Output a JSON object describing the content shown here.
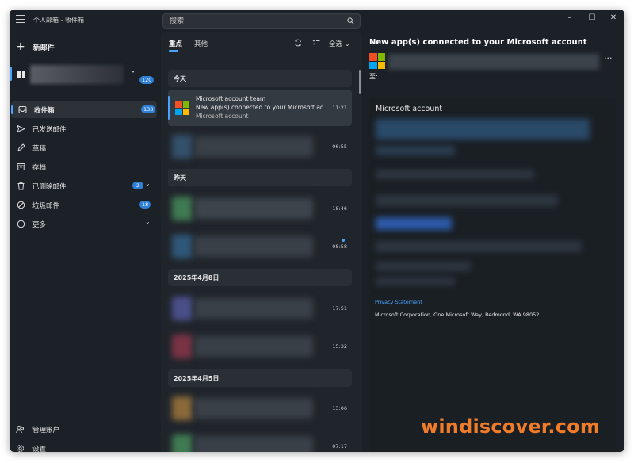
{
  "window": {
    "title": "个人邮箱 - 收件箱",
    "controls": {
      "minimize": "–",
      "maximize": "☐",
      "close": "✕"
    }
  },
  "search": {
    "placeholder": "搜索"
  },
  "sidebar": {
    "new_mail_label": "新邮件",
    "account": {
      "unread_count": "120"
    },
    "folders": [
      {
        "label": "收件箱",
        "count": "133",
        "icon": "inbox-icon"
      },
      {
        "label": "已发送邮件",
        "count": "",
        "icon": "send-icon"
      },
      {
        "label": "草稿",
        "count": "",
        "icon": "pencil-icon"
      },
      {
        "label": "存档",
        "count": "",
        "icon": "archive-icon"
      },
      {
        "label": "已删除邮件",
        "count": "2",
        "icon": "trash-icon"
      },
      {
        "label": "垃圾邮件",
        "count": "18",
        "icon": "block-icon"
      },
      {
        "label": "更多",
        "count": "",
        "icon": "more-icon"
      }
    ],
    "manage_accounts_label": "管理账户",
    "settings_label": "设置"
  },
  "list": {
    "tabs": [
      {
        "label": "重点"
      },
      {
        "label": "其他"
      }
    ],
    "filter_label": "全选",
    "groups": {
      "today": "今天",
      "yesterday": "昨天",
      "date1": "2025年4月8日",
      "date2": "2025年4月5日"
    },
    "items": [
      {
        "sender": "Microsoft account team",
        "subject": "New app(s) connected to your Microsoft account",
        "preview": "Microsoft account",
        "time": "11:21"
      },
      {
        "time": "06:55"
      },
      {
        "time": "18:46"
      },
      {
        "time": "08:58"
      },
      {
        "time": "17:51"
      },
      {
        "time": "15:32"
      },
      {
        "time": "13:06"
      },
      {
        "time": "07:17"
      }
    ]
  },
  "reading": {
    "subject": "New app(s) connected to your Microsoft account",
    "to_label": "至:",
    "more_label": "···",
    "body_title": "Microsoft account",
    "privacy_link": "Privacy Statement",
    "address": "Microsoft Corporation, One Microsoft Way, Redmond, WA 98052"
  },
  "watermark": "windiscover.com",
  "colors": {
    "accent": "#4aa3ff",
    "badge": "#2f7fd6",
    "window_bg": "#1c2127",
    "watermark": "#f07c2a"
  }
}
